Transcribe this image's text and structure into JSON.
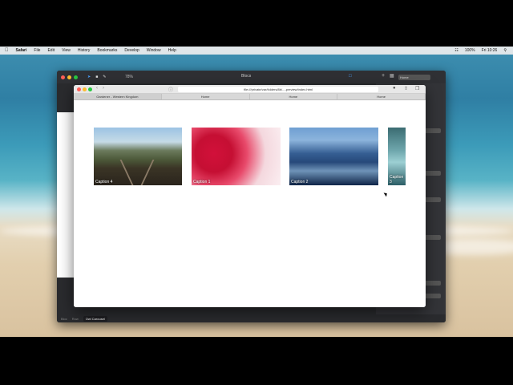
{
  "menubar": {
    "app": "Safari",
    "items": [
      "File",
      "Edit",
      "View",
      "History",
      "Bookmarks",
      "Develop",
      "Window",
      "Help"
    ],
    "battery": "100%",
    "clock": "Fri 10:26"
  },
  "blocs": {
    "title": "Blocs",
    "zoom": "78%",
    "page_select": "Home",
    "bottom_tabs": [
      "Bloc",
      "Row",
      "Owl Carousel"
    ]
  },
  "safari": {
    "url": "file:///private/var/folders/8b/...-preview/index.html",
    "tabs": [
      "Gardener - Western Kingdom",
      "Home",
      "Home",
      "Home"
    ]
  },
  "carousel": {
    "slides": [
      {
        "caption": "Caption 4"
      },
      {
        "caption": "Caption 1"
      },
      {
        "caption": "Caption 2"
      },
      {
        "caption": "Caption 3"
      }
    ]
  },
  "colors": {
    "window_dark": "#2a2b2e",
    "safari_bg": "#ffffff"
  }
}
